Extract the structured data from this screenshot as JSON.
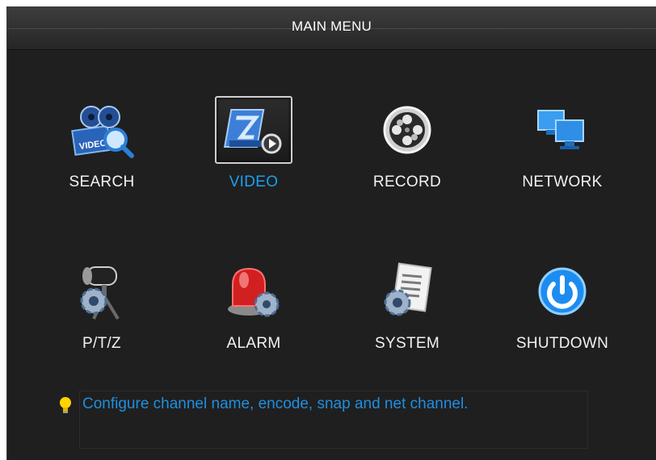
{
  "window": {
    "title": "MAIN MENU"
  },
  "menu": {
    "items": [
      {
        "label": "SEARCH",
        "icon": "search-icon",
        "selected": false
      },
      {
        "label": "VIDEO",
        "icon": "video-icon",
        "selected": true
      },
      {
        "label": "RECORD",
        "icon": "record-icon",
        "selected": false
      },
      {
        "label": "NETWORK",
        "icon": "network-icon",
        "selected": false
      },
      {
        "label": "P/T/Z",
        "icon": "ptz-icon",
        "selected": false
      },
      {
        "label": "ALARM",
        "icon": "alarm-icon",
        "selected": false
      },
      {
        "label": "SYSTEM",
        "icon": "system-icon",
        "selected": false
      },
      {
        "label": "SHUTDOWN",
        "icon": "shutdown-icon",
        "selected": false
      }
    ]
  },
  "hint": {
    "icon": "lightbulb-icon",
    "text": "Configure channel name, encode, snap and net channel."
  },
  "colors": {
    "accent": "#1aa0f0",
    "background": "#1f1f1f",
    "hint_text": "#1f8fe0"
  }
}
